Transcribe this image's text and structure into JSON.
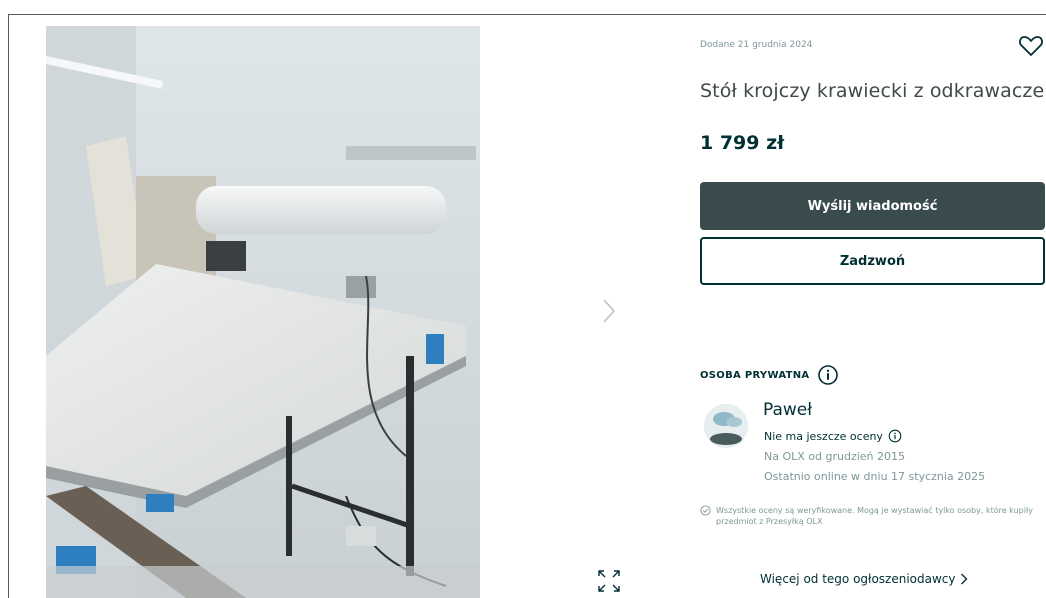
{
  "listing": {
    "added_date": "Dodane 21 grudnia 2024",
    "title": "Stół krojczy krawiecki z odkrawaczem",
    "price": "1 799 zł"
  },
  "actions": {
    "message_label": "Wyślij wiadomość",
    "call_label": "Zadzwoń"
  },
  "seller": {
    "type_label": "OSOBA PRYWATNA",
    "name": "Paweł",
    "rating_text": "Nie ma jeszcze oceny",
    "member_since": "Na OLX od grudzień 2015",
    "last_online": "Ostatnio online w dniu 17 stycznia 2025",
    "verified_note": "Wszystkie oceny są weryfikowane. Mogą je wystawiać tylko osoby, które kupiły przedmiot z Przesyłką OLX",
    "more_link": "Więcej od tego ogłoszeniodawcy"
  },
  "icons": {
    "favorite": "heart-icon",
    "info": "info-icon",
    "next": "chevron-right-icon",
    "expand": "expand-icon",
    "verified": "check-circle-icon"
  },
  "colors": {
    "primary_button": "#3a4b4d",
    "text_dark": "#002f34",
    "text_muted": "#7f9799"
  }
}
